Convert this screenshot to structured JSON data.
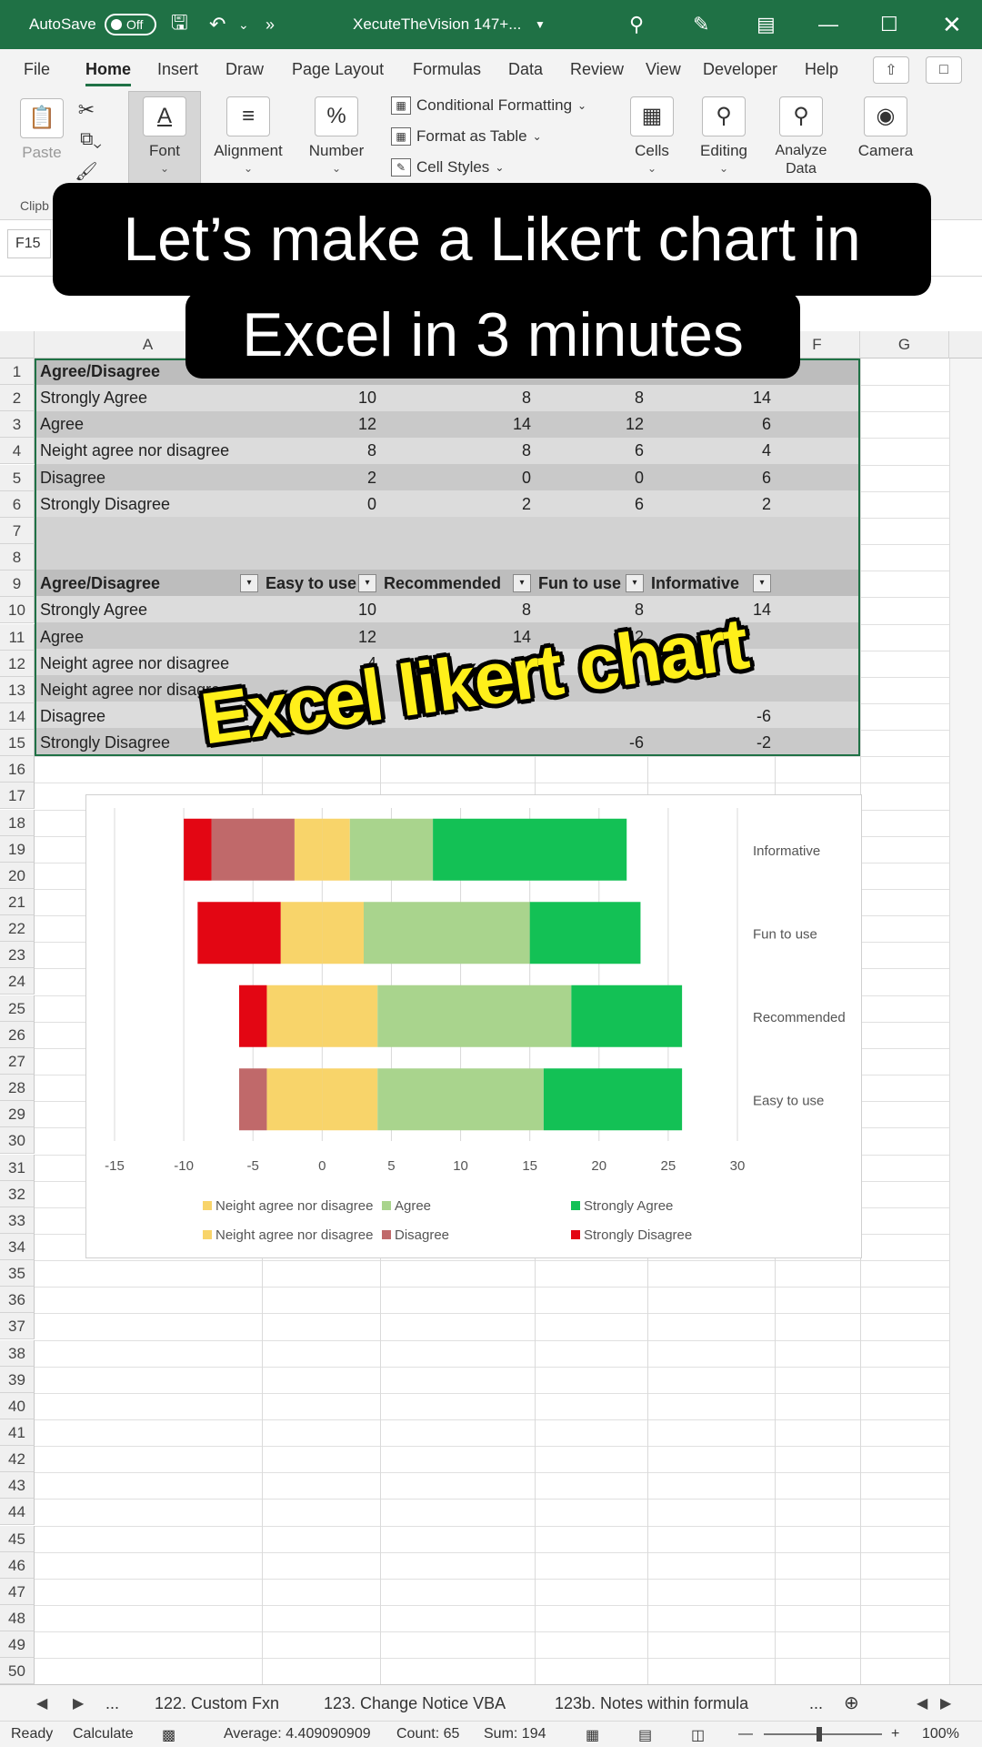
{
  "titlebar": {
    "autosave_label": "AutoSave",
    "autosave_state": "Off",
    "doc_title": "XecuteTheVision 147+..."
  },
  "tabs": [
    "File",
    "Home",
    "Insert",
    "Draw",
    "Page Layout",
    "Formulas",
    "Data",
    "Review",
    "View",
    "Developer",
    "Help"
  ],
  "ribbon": {
    "paste": "Paste",
    "clipboard": "Clipb",
    "font": "Font",
    "alignment": "Alignment",
    "number": "Number",
    "conditional_formatting": "Conditional Formatting",
    "format_as_table": "Format as Table",
    "cell_styles": "Cell Styles",
    "cells": "Cells",
    "editing": "Editing",
    "analyze_data_1": "Analyze",
    "analyze_data_2": "Data",
    "camera": "Camera"
  },
  "formula_bar": {
    "name_box": "F15"
  },
  "columns": [
    "A",
    "F",
    "G"
  ],
  "rows": [
    "1",
    "2",
    "3",
    "4",
    "5",
    "6",
    "7",
    "8",
    "9",
    "10",
    "11",
    "12",
    "13",
    "14",
    "15",
    "16",
    "17",
    "18",
    "19",
    "20",
    "21",
    "22",
    "23",
    "24",
    "25",
    "26",
    "27",
    "28",
    "29",
    "30",
    "31",
    "32",
    "33",
    "34",
    "35",
    "36",
    "37",
    "38",
    "39",
    "40",
    "41",
    "42",
    "43",
    "44",
    "45",
    "46",
    "47",
    "48",
    "49",
    "50"
  ],
  "table1": {
    "header": "Agree/Disagree",
    "rows": [
      [
        "Strongly Agree",
        "10",
        "8",
        "8",
        "14"
      ],
      [
        "Agree",
        "12",
        "14",
        "12",
        "6"
      ],
      [
        "Neight agree nor disagree",
        "8",
        "8",
        "6",
        "4"
      ],
      [
        "Disagree",
        "2",
        "0",
        "0",
        "6"
      ],
      [
        "Strongly Disagree",
        "0",
        "2",
        "6",
        "2"
      ]
    ]
  },
  "table2": {
    "headers": [
      "Agree/Disagree",
      "Easy to use",
      "Recommended",
      "Fun to use",
      "Informative"
    ],
    "rows": [
      [
        "Strongly Agree",
        "10",
        "8",
        "8",
        "14"
      ],
      [
        "Agree",
        "12",
        "14",
        "12",
        ""
      ],
      [
        "Neight agree nor disagree",
        "4",
        "4",
        "",
        ""
      ],
      [
        "Neight agree nor disagree",
        "",
        "",
        "",
        ""
      ],
      [
        "Disagree",
        "",
        "",
        "",
        "-6"
      ],
      [
        "Strongly Disagree",
        "",
        "",
        "-6",
        "-2"
      ]
    ]
  },
  "overlay": {
    "banner_line1": "Let’s make a Likert chart in",
    "banner_line2": "Excel in 3 minutes",
    "sticker": "Excel likert chart"
  },
  "chart_data": {
    "type": "bar",
    "orientation": "horizontal-stacked-diverging",
    "categories": [
      "Easy to use",
      "Recommended",
      "Fun to use",
      "Informative"
    ],
    "series": [
      {
        "name": "Strongly Disagree",
        "color": "#e30613",
        "values": [
          0,
          -2,
          -6,
          -2
        ]
      },
      {
        "name": "Disagree",
        "color": "#c0696a",
        "values": [
          -2,
          0,
          0,
          -6
        ]
      },
      {
        "name": "Neight agree nor disagree",
        "color": "#f8d46a",
        "values": [
          -4,
          -4,
          -3,
          -2
        ]
      },
      {
        "name": "Neight agree nor disagree",
        "color": "#f8d46a",
        "values": [
          4,
          4,
          3,
          2
        ]
      },
      {
        "name": "Agree",
        "color": "#a9d48d",
        "values": [
          12,
          14,
          12,
          6
        ]
      },
      {
        "name": "Strongly Agree",
        "color": "#13c155",
        "values": [
          10,
          8,
          8,
          14
        ]
      }
    ],
    "xticks": [
      "-15",
      "-10",
      "-5",
      "0",
      "5",
      "10",
      "15",
      "20",
      "25",
      "30"
    ],
    "xlim": [
      -15,
      30
    ],
    "grid": true,
    "legend_position": "bottom",
    "legend": [
      {
        "label": "Neight agree nor disagree",
        "color": "#f8d46a"
      },
      {
        "label": "Agree",
        "color": "#a9d48d"
      },
      {
        "label": "Strongly Agree",
        "color": "#13c155"
      },
      {
        "label": "Neight agree nor disagree",
        "color": "#f8d46a"
      },
      {
        "label": "Disagree",
        "color": "#c0696a"
      },
      {
        "label": "Strongly Disagree",
        "color": "#e30613"
      }
    ]
  },
  "sheet_tabs": {
    "more_left": "...",
    "tabs": [
      "122. Custom Fxn",
      "123. Change Notice VBA",
      "123b. Notes within formula"
    ],
    "more_right": "..."
  },
  "status": {
    "ready": "Ready",
    "calculate": "Calculate",
    "average": "Average: 4.409090909",
    "count": "Count: 65",
    "sum": "Sum: 194",
    "zoom": "100%"
  }
}
